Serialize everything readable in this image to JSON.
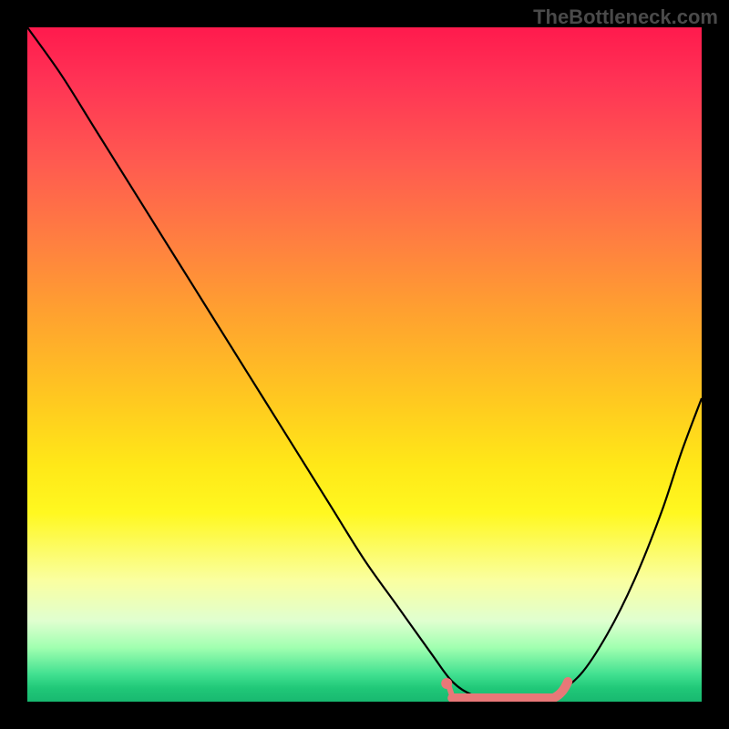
{
  "watermark": "TheBottleneck.com",
  "chart_data": {
    "type": "line",
    "title": "",
    "xlabel": "",
    "ylabel": "",
    "x": [
      0.0,
      0.05,
      0.1,
      0.15,
      0.2,
      0.25,
      0.3,
      0.35,
      0.4,
      0.45,
      0.5,
      0.55,
      0.6,
      0.63,
      0.66,
      0.7,
      0.74,
      0.78,
      0.82,
      0.86,
      0.9,
      0.94,
      0.97,
      1.0
    ],
    "values": [
      1.0,
      0.93,
      0.85,
      0.77,
      0.69,
      0.61,
      0.53,
      0.45,
      0.37,
      0.29,
      0.21,
      0.14,
      0.07,
      0.03,
      0.01,
      0.0,
      0.0,
      0.01,
      0.04,
      0.1,
      0.18,
      0.28,
      0.37,
      0.45
    ],
    "ylim": [
      0,
      1
    ],
    "xlim": [
      0,
      1
    ],
    "highlight_region": {
      "x_start": 0.63,
      "x_end": 0.78,
      "y": 0.0
    },
    "highlight_color": "#e87878",
    "gradient_colors": {
      "top": "#ff1a4d",
      "mid": "#ffe818",
      "bottom": "#18b870"
    }
  }
}
